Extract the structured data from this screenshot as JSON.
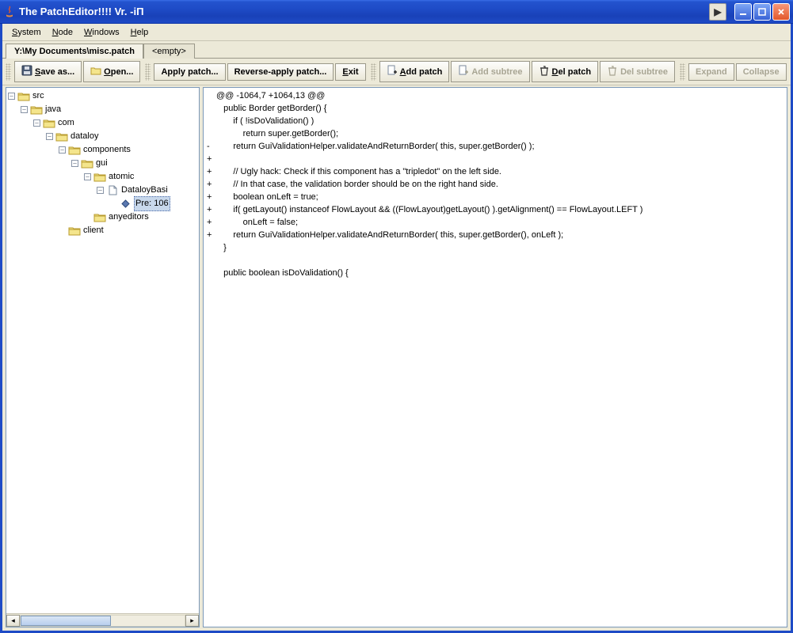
{
  "title": "The PatchEditor!!!! Vr. -iΠ",
  "menu": {
    "system": "System",
    "node": "Node",
    "windows": "Windows",
    "help": "Help"
  },
  "tabs": [
    {
      "label": "Y:\\My Documents\\misc.patch",
      "active": true
    },
    {
      "label": "<empty>",
      "active": false
    }
  ],
  "toolbar1": [
    {
      "id": "save",
      "label": "Save as...",
      "icon": "disk",
      "ul": "S",
      "enabled": true
    },
    {
      "id": "open",
      "label": "Open...",
      "icon": "folder",
      "ul": "O",
      "enabled": true
    }
  ],
  "toolbar2": [
    {
      "id": "apply",
      "label": "Apply patch...",
      "enabled": true,
      "bold": true
    },
    {
      "id": "rapply",
      "label": "Reverse-apply patch...",
      "enabled": true,
      "bold": true
    },
    {
      "id": "exit",
      "label": "Exit",
      "ul": "E",
      "enabled": true,
      "bold": true
    }
  ],
  "toolbar3": [
    {
      "id": "addpatch",
      "label": "Add patch",
      "icon": "file+",
      "ul": "A",
      "enabled": true
    },
    {
      "id": "addsubtree",
      "label": "Add subtree",
      "icon": "file+",
      "enabled": false
    },
    {
      "id": "delpatch",
      "label": "Del patch",
      "icon": "trash",
      "ul": "D",
      "enabled": true
    },
    {
      "id": "delsubtree",
      "label": "Del subtree",
      "icon": "trash",
      "enabled": false
    }
  ],
  "toolbar4": [
    {
      "id": "expand",
      "label": "Expand",
      "enabled": false
    },
    {
      "id": "collapse",
      "label": "Collapse",
      "enabled": false
    }
  ],
  "tree": [
    {
      "depth": 0,
      "handle": "-",
      "icon": "folder",
      "label": "src"
    },
    {
      "depth": 1,
      "handle": "-",
      "icon": "folder",
      "label": "java"
    },
    {
      "depth": 2,
      "handle": "-",
      "icon": "folder",
      "label": "com"
    },
    {
      "depth": 3,
      "handle": "-",
      "icon": "folder",
      "label": "dataloy"
    },
    {
      "depth": 4,
      "handle": "-",
      "icon": "folder",
      "label": "components"
    },
    {
      "depth": 5,
      "handle": "-",
      "icon": "folder",
      "label": "gui"
    },
    {
      "depth": 6,
      "handle": "-",
      "icon": "folder",
      "label": "atomic"
    },
    {
      "depth": 7,
      "handle": "-",
      "icon": "file",
      "label": "DataloyBasi"
    },
    {
      "depth": 8,
      "handle": "",
      "icon": "diamond",
      "label": "Pre: 106",
      "selected": true
    },
    {
      "depth": 6,
      "handle": "",
      "icon": "folder",
      "label": "anyeditors",
      "last": true
    },
    {
      "depth": 4,
      "handle": "",
      "icon": "folder",
      "label": "client",
      "last": true
    }
  ],
  "code": [
    {
      "m": "",
      "t": "@@ -1064,7 +1064,13 @@"
    },
    {
      "m": "",
      "t": "   public Border getBorder() {"
    },
    {
      "m": "",
      "t": "       if ( !isDoValidation() )"
    },
    {
      "m": "",
      "t": "           return super.getBorder();"
    },
    {
      "m": "-",
      "t": "       return GuiValidationHelper.validateAndReturnBorder( this, super.getBorder() );"
    },
    {
      "m": "+",
      "t": ""
    },
    {
      "m": "+",
      "t": "       // Ugly hack: Check if this component has a \"tripledot\" on the left side."
    },
    {
      "m": "+",
      "t": "       // In that case, the validation border should be on the right hand side."
    },
    {
      "m": "+",
      "t": "       boolean onLeft = true;"
    },
    {
      "m": "+",
      "t": "       if( getLayout() instanceof FlowLayout && ((FlowLayout)getLayout() ).getAlignment() == FlowLayout.LEFT )"
    },
    {
      "m": "+",
      "t": "           onLeft = false;"
    },
    {
      "m": "+",
      "t": "       return GuiValidationHelper.validateAndReturnBorder( this, super.getBorder(), onLeft );"
    },
    {
      "m": "",
      "t": "   }"
    },
    {
      "m": "",
      "t": ""
    },
    {
      "m": "",
      "t": "   public boolean isDoValidation() {"
    }
  ]
}
